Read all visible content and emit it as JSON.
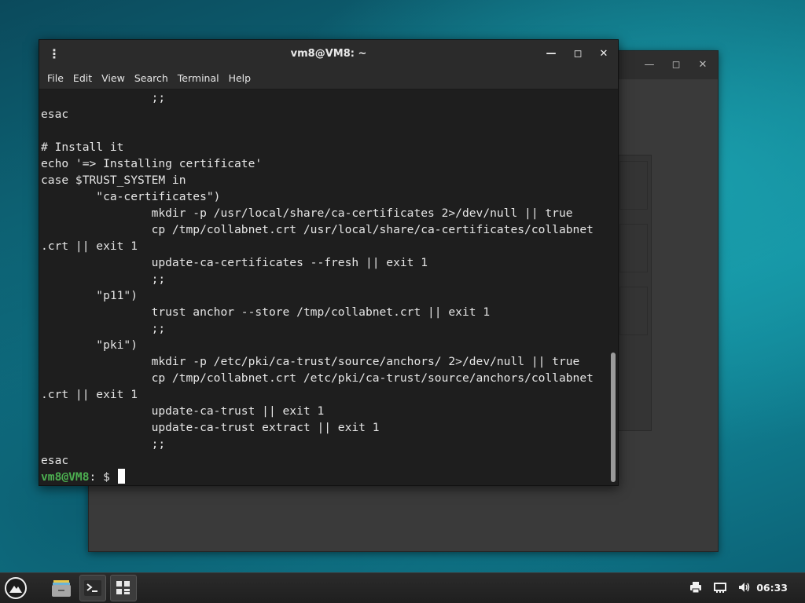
{
  "terminal": {
    "title": "vm8@VM8: ~",
    "menu": [
      "File",
      "Edit",
      "View",
      "Search",
      "Terminal",
      "Help"
    ],
    "lines": [
      "                ;;",
      "esac",
      "",
      "# Install it",
      "echo '=> Installing certificate'",
      "case $TRUST_SYSTEM in",
      "        \"ca-certificates\")",
      "                mkdir -p /usr/local/share/ca-certificates 2>/dev/null || true",
      "                cp /tmp/collabnet.crt /usr/local/share/ca-certificates/collabnet",
      ".crt || exit 1",
      "                update-ca-certificates --fresh || exit 1",
      "                ;;",
      "        \"p11\")",
      "                trust anchor --store /tmp/collabnet.crt || exit 1",
      "                ;;",
      "        \"pki\")",
      "                mkdir -p /etc/pki/ca-trust/source/anchors/ 2>/dev/null || true",
      "                cp /tmp/collabnet.crt /etc/pki/ca-trust/source/anchors/collabnet",
      ".crt || exit 1",
      "                update-ca-trust || exit 1",
      "                update-ca-trust extract || exit 1",
      "                ;;",
      "esac"
    ],
    "prompt_user": "vm8@VM8",
    "prompt_rest": ": $ ",
    "icons": {
      "menu": "kebab-menu-icon",
      "minimize": "minimize-icon",
      "maximize": "maximize-icon",
      "close": "close-icon"
    }
  },
  "background_window": {
    "icons": [
      "minimize-icon",
      "maximize-icon",
      "close-icon"
    ]
  },
  "taskbar": {
    "launcher_icon": "app-launcher-icon",
    "apps": [
      {
        "name": "file-manager-icon",
        "active": false
      },
      {
        "name": "terminal-icon",
        "active": true
      },
      {
        "name": "app-grid-icon",
        "active": true
      }
    ],
    "tray": [
      "printer-icon",
      "network-icon",
      "volume-icon"
    ],
    "clock": "06:33"
  }
}
